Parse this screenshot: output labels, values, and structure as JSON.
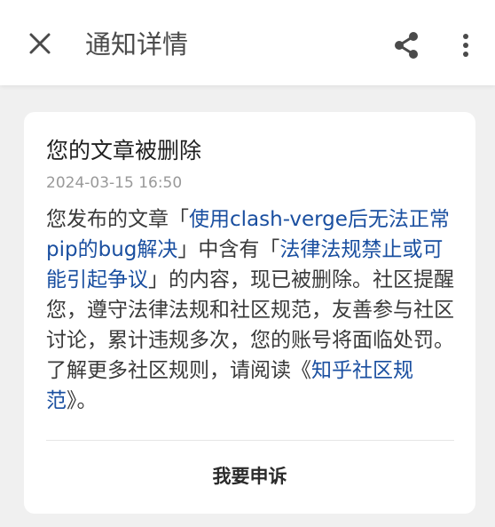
{
  "header": {
    "title": "通知详情",
    "close_icon": "close-icon",
    "share_icon": "share-icon",
    "more_icon": "more-vertical-icon"
  },
  "notification": {
    "title": "您的文章被删除",
    "timestamp": "2024-03-15 16:50",
    "body_prefix": "您发布的文章「",
    "article_link": "使用clash-verge后无法正常pip的bug解决",
    "body_mid": "」中含有「",
    "reason_link": "法律法规禁止或可能引起争议",
    "body_rest": "」的内容，现已被删除。社区提醒您，遵守法律法规和社区规范，友善参与社区讨论，累计违规多次，您的账号将面临处罚。了解更多社区规则，请阅读《",
    "rules_link": "知乎社区规范",
    "body_end": "》。",
    "appeal_label": "我要申诉"
  },
  "colors": {
    "link": "#1a4fa0",
    "background": "#f0f0f0"
  }
}
